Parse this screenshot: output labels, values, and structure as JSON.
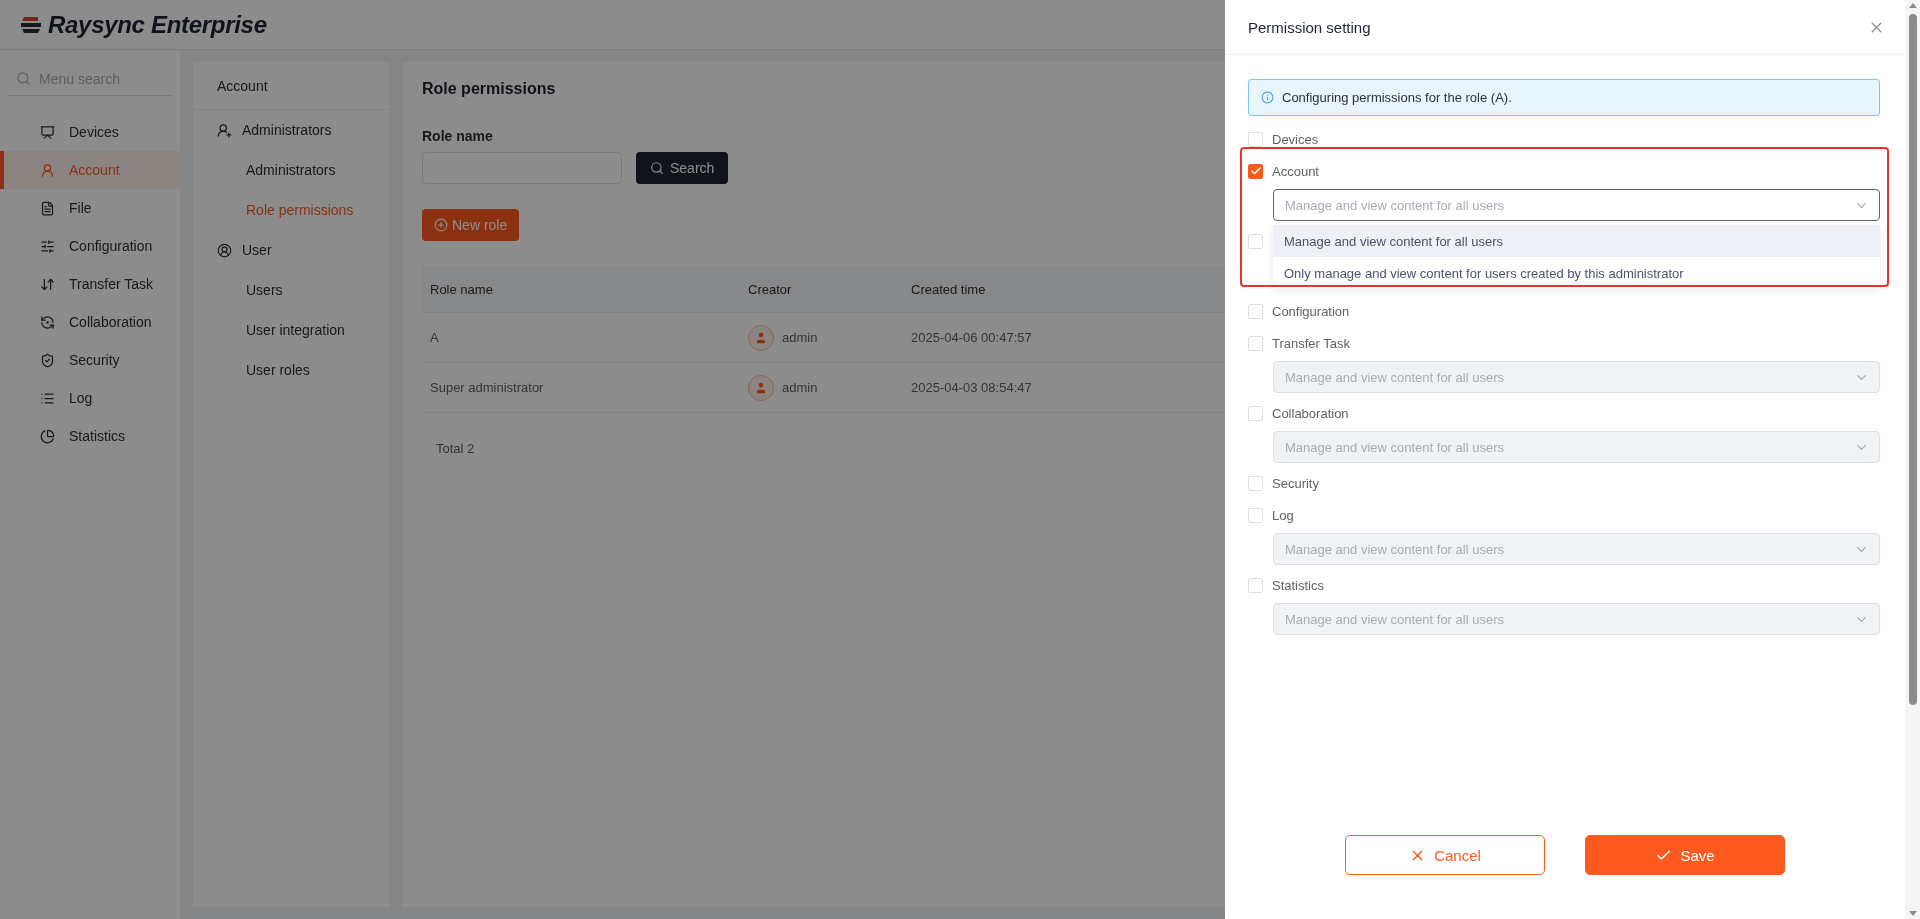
{
  "app": {
    "logo": "Raysync Enterprise"
  },
  "sidebar": {
    "search": {
      "placeholder": "Menu search"
    },
    "items": [
      {
        "label": "Devices",
        "selected": false
      },
      {
        "label": "Account",
        "selected": true
      },
      {
        "label": "File",
        "selected": false
      },
      {
        "label": "Configuration",
        "selected": false
      },
      {
        "label": "Transfer Task",
        "selected": false
      },
      {
        "label": "Collaboration",
        "selected": false
      },
      {
        "label": "Security",
        "selected": false
      },
      {
        "label": "Log",
        "selected": false
      },
      {
        "label": "Statistics",
        "selected": false
      }
    ]
  },
  "subnav": {
    "title": "Account",
    "groups": [
      {
        "label": "Administrators",
        "children": [
          {
            "label": "Administrators",
            "selected": false
          },
          {
            "label": "Role permissions",
            "selected": true
          }
        ]
      },
      {
        "label": "User",
        "children": [
          {
            "label": "Users",
            "selected": false
          },
          {
            "label": "User integration",
            "selected": false
          },
          {
            "label": "User roles",
            "selected": false
          }
        ]
      }
    ]
  },
  "main": {
    "title": "Role permissions",
    "filter": {
      "label": "Role name",
      "button": "Search"
    },
    "new_button": "New role",
    "table": {
      "columns": [
        "Role name",
        "Creator",
        "Created time"
      ],
      "rows": [
        {
          "role_name": "A",
          "creator": "admin",
          "created_time": "2025-04-06 00:47:57"
        },
        {
          "role_name": "Super administrator",
          "creator": "admin",
          "created_time": "2025-04-03 08:54:47"
        }
      ]
    },
    "total": "Total 2"
  },
  "drawer": {
    "title": "Permission setting",
    "notice": "Configuring permissions for the role (A).",
    "permissions": [
      {
        "kind": "plain",
        "label": "Devices",
        "checked": false
      },
      {
        "kind": "select",
        "label": "Account",
        "checked": true,
        "highlighted": true,
        "select": {
          "placeholder": "Manage and view content for all users",
          "disabled": false,
          "expanded": true,
          "options": [
            {
              "label": "Manage and view content for all users",
              "selected": true
            },
            {
              "label": "Only manage and view content for users created by this administrator",
              "selected": false
            }
          ]
        }
      },
      {
        "kind": "covered",
        "checked": false
      },
      {
        "kind": "plain",
        "label": "Configuration",
        "checked": false
      },
      {
        "kind": "select",
        "label": "Transfer Task",
        "checked": false,
        "select": {
          "placeholder": "Manage and view content for all users",
          "disabled": true,
          "expanded": false
        }
      },
      {
        "kind": "select",
        "label": "Collaboration",
        "checked": false,
        "select": {
          "placeholder": "Manage and view content for all users",
          "disabled": true,
          "expanded": false
        }
      },
      {
        "kind": "plain",
        "label": "Security",
        "checked": false
      },
      {
        "kind": "select",
        "label": "Log",
        "checked": false,
        "select": {
          "placeholder": "Manage and view content for all users",
          "disabled": true,
          "expanded": false
        }
      },
      {
        "kind": "select",
        "label": "Statistics",
        "checked": false,
        "select": {
          "placeholder": "Manage and view content for all users",
          "disabled": true,
          "expanded": false
        }
      }
    ],
    "buttons": {
      "cancel": "Cancel",
      "save": "Save"
    }
  }
}
